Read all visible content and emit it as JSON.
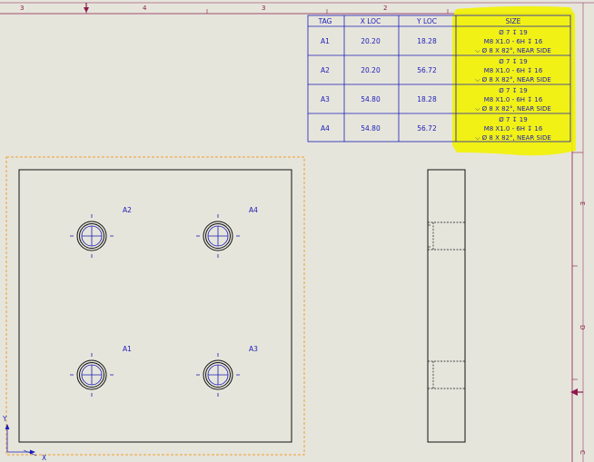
{
  "border": {
    "top_zones": [
      "3",
      "4",
      "3",
      "2"
    ],
    "right_zones": [
      "E",
      "D",
      "C"
    ]
  },
  "hole_table": {
    "headers": [
      "TAG",
      "X LOC",
      "Y LOC",
      "SIZE"
    ],
    "rows": [
      {
        "tag": "A1",
        "x": "20.20",
        "y": "18.28",
        "size": [
          "Ø 7 ↧ 19",
          "M8 X1.0 - 6H ↧ 16",
          "⌵ Ø 8 X 82°, NEAR SIDE"
        ]
      },
      {
        "tag": "A2",
        "x": "20.20",
        "y": "56.72",
        "size": [
          "Ø 7 ↧ 19",
          "M8 X1.0 - 6H ↧ 16",
          "⌵ Ø 8 X 82°, NEAR SIDE"
        ]
      },
      {
        "tag": "A3",
        "x": "54.80",
        "y": "18.28",
        "size": [
          "Ø 7 ↧ 19",
          "M8 X1.0 - 6H ↧ 16",
          "⌵ Ø 8 X 82°, NEAR SIDE"
        ]
      },
      {
        "tag": "A4",
        "x": "54.80",
        "y": "56.72",
        "size": [
          "Ø 7 ↧ 19",
          "M8 X1.0 - 6H ↧ 16",
          "⌵ Ø 8 X 82°, NEAR SIDE"
        ]
      }
    ],
    "highlight_color": "#f2f200"
  },
  "front_view": {
    "hole_labels": [
      "A2",
      "A4",
      "A1",
      "A3"
    ]
  },
  "triad": {
    "y_label": "Y",
    "x_label": "X"
  },
  "colors": {
    "sheet": "#e6e5dc",
    "annotation": "#1c1cb8",
    "border": "#8b1a4a",
    "selection": "#f0a030",
    "geometry": "#111111"
  }
}
